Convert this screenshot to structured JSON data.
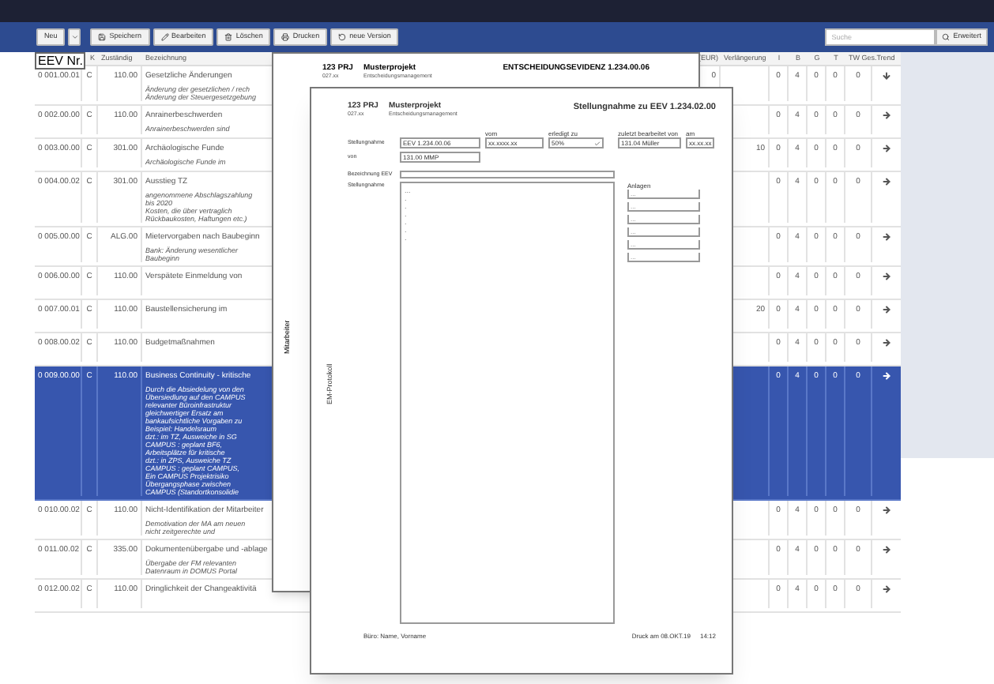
{
  "toolbar": {
    "buttons": [
      {
        "kind": "plain",
        "label": "Neu"
      },
      {
        "kind": "dropdown"
      },
      {
        "kind": "save",
        "label": "Speichern"
      },
      {
        "kind": "edit",
        "label": "Bearbeiten"
      },
      {
        "kind": "delete",
        "label": "Löschen"
      },
      {
        "kind": "print",
        "label": "Drucken"
      },
      {
        "kind": "version",
        "label": "neue Version"
      }
    ],
    "search": {
      "placeholder": "Suche"
    },
    "advanced_button": "Erweitert"
  },
  "table": {
    "columns": [
      "EEV Nr.",
      "K",
      "Zuständig",
      "Bezeichnung",
      "(EUR)",
      "Verlängerung",
      "I",
      "B",
      "G",
      "T",
      "TW Ges.",
      "Trend"
    ],
    "rows": [
      {
        "selected": false,
        "nr": "0 001.00.01",
        "k": "C",
        "zustaendig": "110.00",
        "title": "Gesetzliche Änderungen",
        "desc": [
          "Änderung der gesetzlichen / rech",
          "Änderung der Steuergesetzgebung"
        ],
        "eur": "0",
        "verlaengerung": "",
        "i": "0",
        "b": "4",
        "g": "0",
        "t": "0",
        "tw": "0",
        "trend": {
          "kind": "down"
        }
      },
      {
        "selected": false,
        "nr": "0 002.00.00",
        "k": "C",
        "zustaendig": "110.00",
        "title": "Anrainerbeschwerden",
        "desc": [
          "Anrainerbeschwerden sind"
        ],
        "eur": "",
        "verlaengerung": "",
        "i": "0",
        "b": "4",
        "g": "0",
        "t": "0",
        "tw": "0",
        "trend": {
          "kind": "right"
        }
      },
      {
        "selected": false,
        "nr": "0 003.00.00",
        "k": "C",
        "zustaendig": "301.00",
        "title": "Archäologische Funde",
        "desc": [
          "Archäologische Funde im"
        ],
        "eur": "",
        "verlaengerung": "10",
        "i": "0",
        "b": "4",
        "g": "0",
        "t": "0",
        "tw": "0",
        "trend": {
          "kind": "right"
        }
      },
      {
        "selected": false,
        "nr": "0 004.00.02",
        "k": "C",
        "zustaendig": "301.00",
        "title": "Ausstieg TZ",
        "desc": [
          "angenommene Abschlagszahlung",
          "bis 2020",
          "Kosten, die über vertraglich",
          "Rückbaukosten, Haftungen etc.)"
        ],
        "eur": "",
        "verlaengerung": "",
        "i": "0",
        "b": "4",
        "g": "0",
        "t": "0",
        "tw": "0",
        "trend": {
          "kind": "right"
        }
      },
      {
        "selected": false,
        "nr": "0 005.00.00",
        "k": "C",
        "zustaendig": "ALG.00",
        "title": "Mietervorgaben nach Baubeginn",
        "desc": [
          "Bank: Änderung wesentlicher",
          "Baubeginn"
        ],
        "eur": "",
        "verlaengerung": "",
        "i": "0",
        "b": "4",
        "g": "0",
        "t": "0",
        "tw": "0",
        "trend": {
          "kind": "right"
        }
      },
      {
        "selected": false,
        "nr": "0 006.00.00",
        "k": "C",
        "zustaendig": "110.00",
        "title": "Verspätete Einmeldung von",
        "desc": [],
        "eur": "",
        "verlaengerung": "",
        "i": "0",
        "b": "4",
        "g": "0",
        "t": "0",
        "tw": "0",
        "trend": {
          "kind": "right"
        }
      },
      {
        "selected": false,
        "nr": "0 007.00.01",
        "k": "C",
        "zustaendig": "110.00",
        "title": "Baustellensicherung im",
        "desc": [],
        "eur": "",
        "verlaengerung": "20",
        "i": "0",
        "b": "4",
        "g": "0",
        "t": "0",
        "tw": "0",
        "trend": {
          "kind": "right"
        }
      },
      {
        "selected": false,
        "nr": "0 008.00.02",
        "k": "C",
        "zustaendig": "110.00",
        "title": "Budgetmaßnahmen",
        "desc": [],
        "eur": "",
        "verlaengerung": "",
        "i": "0",
        "b": "4",
        "g": "0",
        "t": "0",
        "tw": "0",
        "trend": {
          "kind": "right"
        }
      },
      {
        "selected": true,
        "nr": "0 009.00.00",
        "k": "C",
        "zustaendig": "110.00",
        "title": "Business Continuity - kritische",
        "desc": [
          "Durch die Absiedelung von den",
          "Übersiedlung auf den CAMPUS",
          "relevanter Büroinfrastruktur",
          "gleichwertiger Ersatz am",
          "bankaufsichtliche Vorgaben zu",
          "Beispiel: Handelsraum",
          "dzt.: im TZ, Ausweiche in SG",
          "CAMPUS : geplant BF6,",
          "Arbeitsplätze für kritische",
          "dzt.: in ZPS, Ausweiche TZ",
          "CAMPUS : geplant CAMPUS,",
          "Ein CAMPUS Projektrisiko",
          "Übergangsphase zwischen",
          "CAMPUS (Standortkonsolidie"
        ],
        "eur": "",
        "verlaengerung": "",
        "i": "0",
        "b": "4",
        "g": "0",
        "t": "0",
        "tw": "0",
        "trend": {
          "kind": "right"
        }
      },
      {
        "selected": false,
        "nr": "0 010.00.02",
        "k": "C",
        "zustaendig": "110.00",
        "title": "Nicht-Identifikation der Mitarbeiter",
        "desc": [
          "Demotivation der MA am neuen",
          "nicht zeitgerechte und"
        ],
        "eur": "",
        "verlaengerung": "",
        "i": "0",
        "b": "4",
        "g": "0",
        "t": "0",
        "tw": "0",
        "trend": {
          "kind": "right"
        }
      },
      {
        "selected": false,
        "nr": "0 011.00.02",
        "k": "C",
        "zustaendig": "335.00",
        "title": "Dokumentenübergabe und -ablage",
        "desc": [
          "Übergabe der FM relevanten",
          "Datenraum in DOMUS Portal"
        ],
        "eur": "",
        "verlaengerung": "",
        "i": "0",
        "b": "4",
        "g": "0",
        "t": "0",
        "tw": "0",
        "trend": {
          "kind": "right"
        }
      },
      {
        "selected": false,
        "nr": "0 012.00.02",
        "k": "C",
        "zustaendig": "110.00",
        "title": "Dringlichkeit der Changeaktivitä",
        "desc": [],
        "eur": "",
        "verlaengerung": "",
        "i": "0",
        "b": "4",
        "g": "0",
        "t": "0",
        "tw": "0",
        "trend": {
          "kind": "right"
        }
      }
    ]
  },
  "evidence_sheet": {
    "project_code": "123 PRJ",
    "project_sub": "027.xx",
    "project_name": "Musterprojekt",
    "project_area": "Entscheidungsmanagement",
    "title": "ENTSCHEIDUNGSEVIDENZ 1.234.00.06",
    "side_label": "Mitarbeiter"
  },
  "statement_sheet": {
    "project_code": "123 PRJ",
    "project_sub": "027.xx",
    "project_name": "Musterprojekt",
    "project_area": "Entscheidungsmanagement",
    "title": "Stellungnahme zu EEV 1.234.02.00",
    "side_label": "EM-Protokoll",
    "row_label": "Stellungnahme",
    "fields": [
      {
        "value": "EEV 1.234.00.06"
      },
      {
        "caption": "vom",
        "value": "xx.xxxx.xx"
      },
      {
        "caption": "erledigt zu",
        "value": "50%"
      },
      {
        "caption": "zuletzt bearbeitet von",
        "value": "131.04 Müller"
      },
      {
        "caption": "am",
        "value": "xx.xx.xx"
      }
    ],
    "by_label": "von",
    "by_value": "131.00 MMP",
    "name_label": "Bezeichnung EEV",
    "text_label": "Stellungnahme",
    "text_lines": [
      "...",
      ".",
      ".",
      ".",
      ".",
      ".",
      "."
    ],
    "attachments_label": "Anlagen",
    "attachments": [
      "...",
      "...",
      "...",
      "...",
      "...",
      "..."
    ],
    "footer_left": "Büro: Name, Vorname",
    "footer_date": "Druck am 08.OKT.19",
    "footer_time": "14:12"
  }
}
